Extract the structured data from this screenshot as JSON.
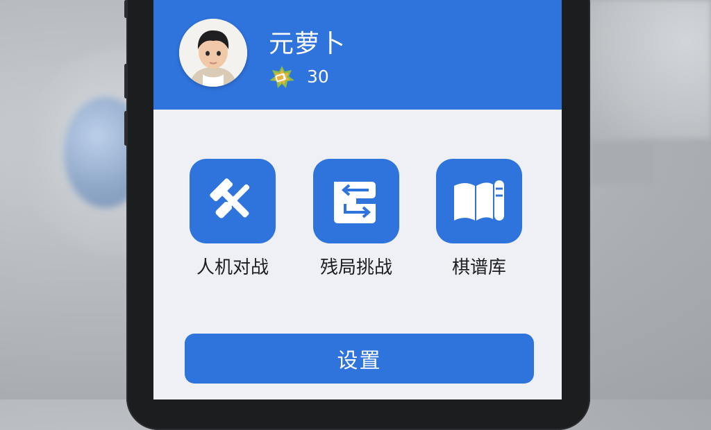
{
  "user": {
    "name": "元萝卜",
    "score": "30",
    "avatar_icon": "child-avatar",
    "badge_icon": "level-badge-icon"
  },
  "features": [
    {
      "label": "人机对战",
      "icon": "crossed-tools-icon"
    },
    {
      "label": "残局挑战",
      "icon": "swap-arrows-icon"
    },
    {
      "label": "棋谱库",
      "icon": "book-scroll-icon"
    }
  ],
  "settings": {
    "label": "设置"
  },
  "colors": {
    "accent": "#2f73dc",
    "background": "#eef0f5",
    "text": "#1d1d1f"
  }
}
